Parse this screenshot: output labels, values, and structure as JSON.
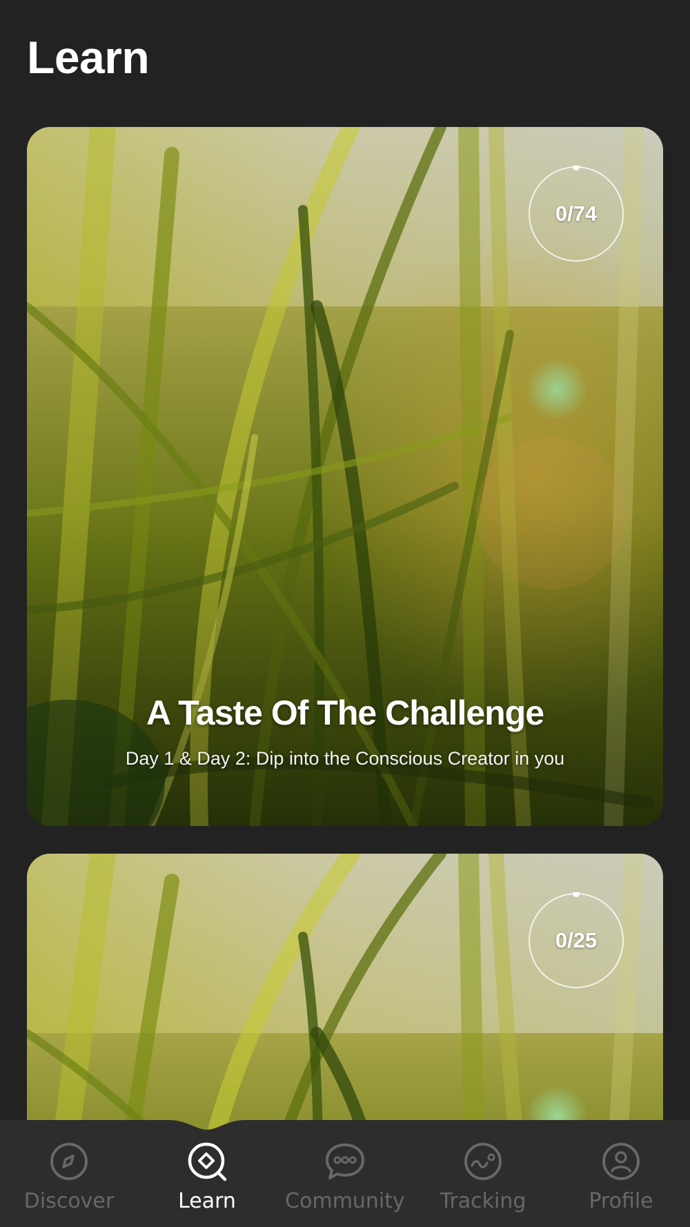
{
  "header": {
    "title": "Learn"
  },
  "cards": [
    {
      "title": "A Taste Of The Challenge",
      "subtitle": "Day 1 & Day 2: Dip into the Conscious Creator in you",
      "progress": "0/74",
      "progress_fraction": 0
    },
    {
      "title": "",
      "subtitle": "",
      "progress": "0/25",
      "progress_fraction": 0
    }
  ],
  "tabbar": {
    "active": "Learn",
    "items": [
      {
        "label": "Discover",
        "icon": "compass-icon"
      },
      {
        "label": "Learn",
        "icon": "learn-icon"
      },
      {
        "label": "Community",
        "icon": "chat-bubble-icon"
      },
      {
        "label": "Tracking",
        "icon": "tracking-icon"
      },
      {
        "label": "Profile",
        "icon": "profile-icon"
      }
    ]
  },
  "colors": {
    "background": "#222222",
    "tabbar": "#2d2d2d",
    "tab_inactive": "#686868",
    "tab_active": "#ffffff"
  }
}
